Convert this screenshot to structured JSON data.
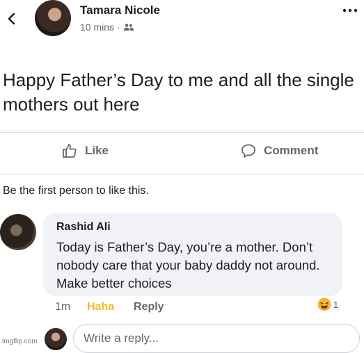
{
  "header": {
    "author": "Tamara Nicole",
    "time": "10 mins",
    "separator": "·"
  },
  "post": {
    "text": "Happy Father’s Day to me and all the single mothers out here"
  },
  "actions": {
    "like_label": "Like",
    "comment_label": "Comment"
  },
  "likes_summary": "Be the first person to like this.",
  "comment": {
    "author": "Rashid Ali",
    "text": "Today is Father’s Day, you’re a mother. Don’t nobody care that your baby daddy not around. Make better choices",
    "time": "1m",
    "reaction_label": "Haha",
    "reply_label": "Reply",
    "reaction_count": "1"
  },
  "reply_bar": {
    "placeholder": "Write a reply..."
  },
  "watermark": "imgflip.com",
  "colors": {
    "haha": "#f7b928",
    "secondary_text": "#65676b",
    "bubble": "#f0f2f5"
  },
  "icons": [
    "back-arrow-icon",
    "friends-icon",
    "more-icon",
    "like-icon",
    "comment-icon",
    "haha-emoji-icon"
  ]
}
